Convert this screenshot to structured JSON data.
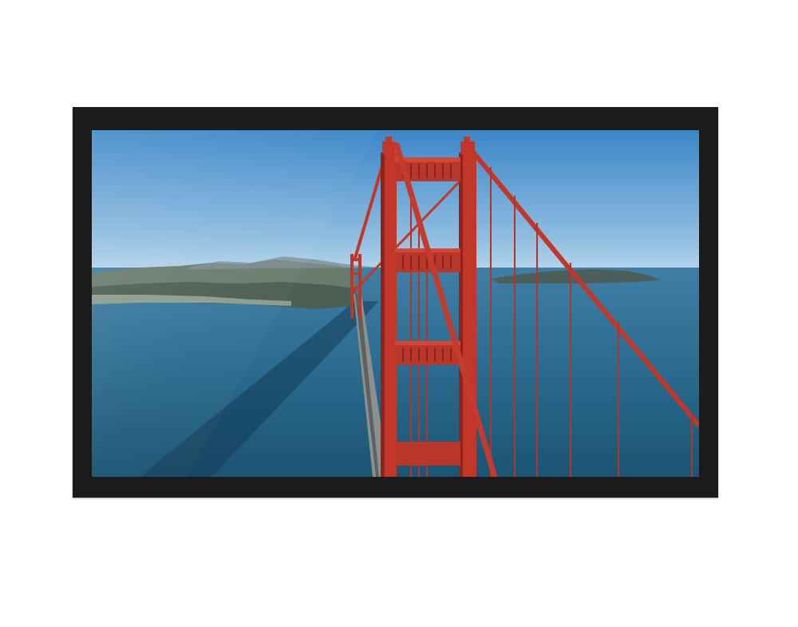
{
  "scene": {
    "subject": "suspension-bridge-aerial-view",
    "colors": {
      "bezel": "#1b1b1b",
      "sky_top": "#3b86c8",
      "sky_horizon": "#b9d7ec",
      "sea_far": "#3f7fa6",
      "sea_near": "#1e5a7a",
      "bridge_red": "#c1382a",
      "bridge_shadow": "#7e1f16",
      "land": "#6f7f72"
    }
  }
}
